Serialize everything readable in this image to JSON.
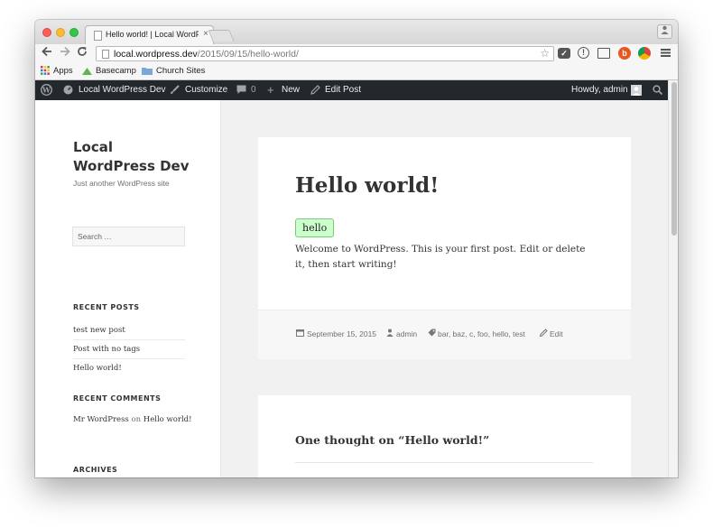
{
  "browser": {
    "tab_title": "Hello world! | Local WordPress",
    "tab_close": "×",
    "url_host": "local.wordpress.dev",
    "url_path": "/2015/09/15/hello-world/",
    "bookmarks": [
      "Apps",
      "Basecamp",
      "Church Sites"
    ],
    "icons": [
      "back-icon",
      "forward-icon",
      "reload-icon",
      "page-icon",
      "star-icon",
      "pocket-icon",
      "extension-icon",
      "screenshot-icon",
      "ghostery-icon",
      "chrome-icon",
      "menu-icon",
      "profile-icon"
    ]
  },
  "adminbar": {
    "site_name": "Local WordPress Dev",
    "customize": "Customize",
    "comments_count": "0",
    "new_label": "New",
    "edit_post": "Edit Post",
    "howdy": "Howdy, admin"
  },
  "sidebar": {
    "site_title": "Local WordPress Dev",
    "site_description": "Just another WordPress site",
    "search_placeholder": "Search …",
    "recent_posts_title": "RECENT POSTS",
    "recent_posts": [
      "test new post",
      "Post with no tags",
      "Hello world!"
    ],
    "recent_comments_title": "RECENT COMMENTS",
    "comment_author": "Mr WordPress",
    "comment_on": "on",
    "comment_post": "Hello world!",
    "archives_title": "ARCHIVES"
  },
  "post": {
    "title": "Hello world!",
    "tag_highlight": "hello",
    "body": "Welcome to WordPress. This is your first post. Edit or delete it, then start writing!",
    "date": "September 15, 2015",
    "author": "admin",
    "tags": "bar, baz, c, foo, hello, test",
    "edit": "Edit"
  },
  "comments": {
    "title": "One thought on “Hello world!”"
  },
  "colors": {
    "admin_bar": "#23282d",
    "tag_bg": "#ccffcc",
    "page_bg": "#f1f1f1"
  }
}
